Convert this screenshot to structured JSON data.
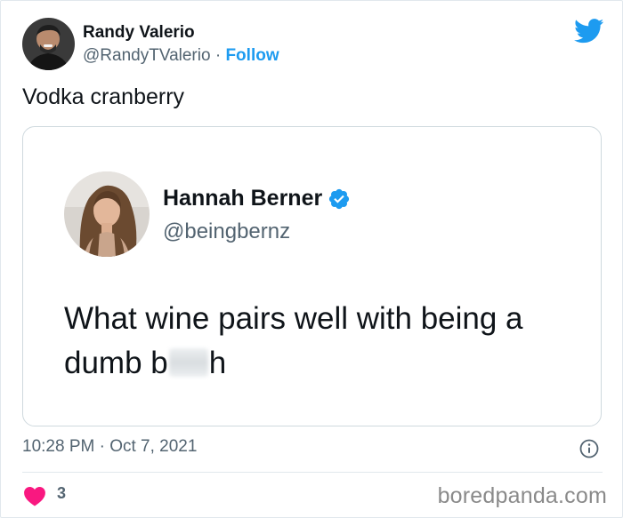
{
  "author": {
    "name": "Randy Valerio",
    "handle": "@RandyTValerio",
    "separator": "·",
    "follow_label": "Follow"
  },
  "tweet": {
    "text": "Vodka cranberry"
  },
  "quoted": {
    "name": "Hannah Berner",
    "handle": "@beingbernz",
    "text_line1": "What wine pairs well with being a",
    "text_line2_prefix": "dumb b",
    "text_line2_suffix": "h",
    "verified": true
  },
  "footer": {
    "timestamp": "10:28 PM · Oct 7, 2021",
    "like_count": "3",
    "watermark": "boredpanda.com"
  },
  "colors": {
    "twitter_blue": "#1d9bf0",
    "heart_red": "#f91880",
    "text_primary": "#0f1419",
    "text_secondary": "#536471"
  },
  "icons": [
    "twitter-bird-icon",
    "verified-badge-icon",
    "info-icon",
    "heart-icon"
  ]
}
